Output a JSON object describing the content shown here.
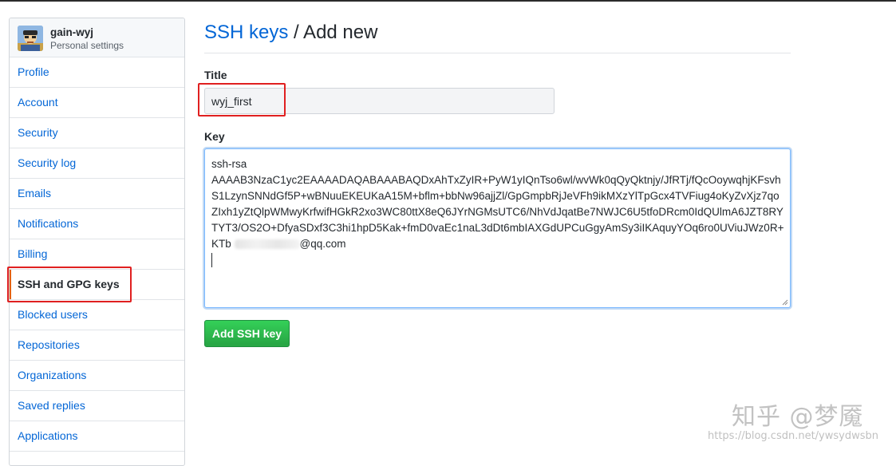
{
  "sidebar": {
    "user": {
      "name": "gain-wyj",
      "subtitle": "Personal settings"
    },
    "items": [
      {
        "label": "Profile"
      },
      {
        "label": "Account"
      },
      {
        "label": "Security"
      },
      {
        "label": "Security log"
      },
      {
        "label": "Emails"
      },
      {
        "label": "Notifications"
      },
      {
        "label": "Billing"
      },
      {
        "label": "SSH and GPG keys",
        "selected": true
      },
      {
        "label": "Blocked users"
      },
      {
        "label": "Repositories"
      },
      {
        "label": "Organizations"
      },
      {
        "label": "Saved replies"
      },
      {
        "label": "Applications"
      }
    ]
  },
  "main": {
    "breadcrumb_link": "SSH keys",
    "breadcrumb_rest": " / Add new",
    "title_label": "Title",
    "title_value": "wyj_first",
    "key_label": "Key",
    "key_lines": [
      "ssh-rsa",
      "AAAAB3NzaC1yc2EAAAADAQABAAABAQDxAhTxZyIR+PyW1yIQnTso6wl/wvWk0qQyQktnjy/JfRTj/fQcOoywqhjKFsvh",
      "S1LzynSNNdGf5P+wBNuuEKEUKaA15M+bflm+bbNw96ajjZl/GpGmpbRjJeVFh9ikMXzYlTpGcx4TVFiug4oKyZvXjz7qo",
      "ZIxh1yZtQlpWMwyKrfwifHGkR2xo3WC80ttX8eQ6JYrNGMsUTC6/NhVdJqatBe7NWJC6U5tfoDRcm0IdQUlmA6JZT8RY",
      "TYT3/OS2O+DfyaSDxf3C3hi1hpD5Kak+fmD0vaEc1naL3dDt6mbIAXGdUPCuGgyAmSy3iIKAquyYOq6ro0UViuJWz0R+"
    ],
    "key_last_prefix": "KTb ",
    "key_last_suffix": "@qq.com",
    "submit_label": "Add SSH key"
  },
  "watermark": {
    "brand": "知乎 @梦魇",
    "url": "https://blog.csdn.net/ywsydwsbn"
  },
  "colors": {
    "link": "#0366d6",
    "highlight_box": "#e02020",
    "button_green": "#28a745",
    "selected_accent": "#e36209"
  }
}
